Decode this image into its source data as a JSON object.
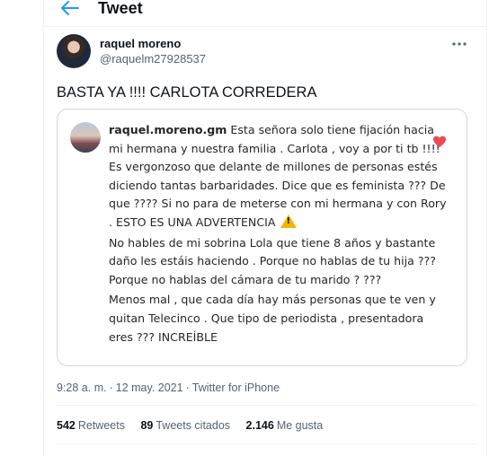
{
  "header": {
    "title": "Tweet"
  },
  "tweet": {
    "author_name": "raquel moreno",
    "author_handle": "@raquelm27928537",
    "text": "BASTA YA !!!! CARLOTA CORREDERA",
    "timestamp": "9:28 a. m.",
    "date": "12 may. 2021",
    "source": "Twitter for iPhone"
  },
  "media": {
    "username": "raquel.moreno.gm",
    "para1_a": " Esta señora solo tiene fijación hacia mi hermana y nuestra familia . Carlota , voy a por ti tb !!!! Es vergonzoso que delante de millones de personas estés diciendo tantas barbaridades. Dice que es feminista ??? De que ???? Si no para de meterse con mi hermana y con Rory .  ESTO ES UNA ADVERTENCIA ",
    "para2": "No hables de mi sobrina Lola que tiene 8 años y bastante daño les estáis haciendo . Porque no hablas de tu hija ??? Porque no hablas del cámara de tu marido ? ???",
    "para3": "Menos mal , que cada día hay más personas que te ven y quitan Telecinco .  Que tipo de periodista , presentadora eres ??? INCREÍBLE",
    "heart_color": "#ed4956",
    "warning_color": "#f5b400"
  },
  "stats": {
    "retweets_count": "542",
    "retweets_label": "Retweets",
    "quotes_count": "89",
    "quotes_label": "Tweets citados",
    "likes_count": "2.146",
    "likes_label": "Me gusta"
  },
  "icons": {
    "back": "back-arrow-icon",
    "more": "more-icon",
    "heart": "heart-icon",
    "warning": "warning-icon"
  },
  "colors": {
    "accent": "#1d9bf0",
    "secondary_text": "#536471"
  }
}
